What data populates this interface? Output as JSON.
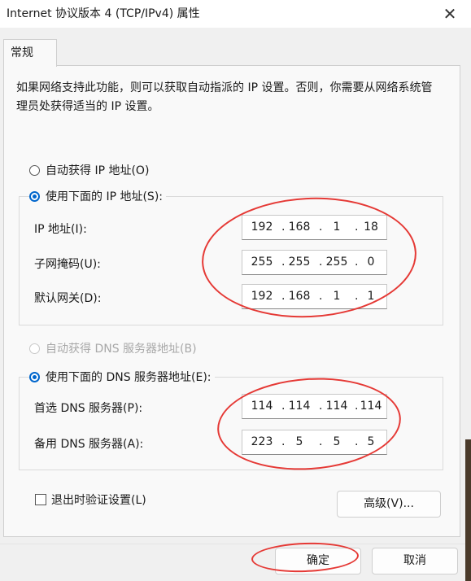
{
  "window": {
    "title": "Internet 协议版本 4 (TCP/IPv4) 属性",
    "close_icon": "close-icon"
  },
  "tabs": [
    {
      "label": "常规",
      "selected": true
    }
  ],
  "description": "如果网络支持此功能，则可以获取自动指派的 IP 设置。否则，你需要从网络系统管理员处获得适当的 IP 设置。",
  "ip_section": {
    "auto_label": "自动获得 IP 地址(O)",
    "auto_selected": false,
    "manual_label": "使用下面的 IP 地址(S):",
    "manual_selected": true,
    "fields": [
      {
        "label": "IP 地址(I):",
        "octets": [
          "192",
          "168",
          "1",
          "18"
        ]
      },
      {
        "label": "子网掩码(U):",
        "octets": [
          "255",
          "255",
          "255",
          "0"
        ]
      },
      {
        "label": "默认网关(D):",
        "octets": [
          "192",
          "168",
          "1",
          "1"
        ]
      }
    ]
  },
  "dns_section": {
    "auto_label": "自动获得 DNS 服务器地址(B)",
    "auto_selected": false,
    "auto_disabled": true,
    "manual_label": "使用下面的 DNS 服务器地址(E):",
    "manual_selected": true,
    "fields": [
      {
        "label": "首选 DNS 服务器(P):",
        "octets": [
          "114",
          "114",
          "114",
          "114"
        ]
      },
      {
        "label": "备用 DNS 服务器(A):",
        "octets": [
          "223",
          "5",
          "5",
          "5"
        ]
      }
    ]
  },
  "validate_on_exit": {
    "label": "退出时验证设置(L)",
    "checked": false
  },
  "buttons": {
    "advanced": "高级(V)...",
    "ok": "确定",
    "cancel": "取消"
  },
  "colors": {
    "accent": "#0066cc",
    "annotation": "#e53935"
  }
}
